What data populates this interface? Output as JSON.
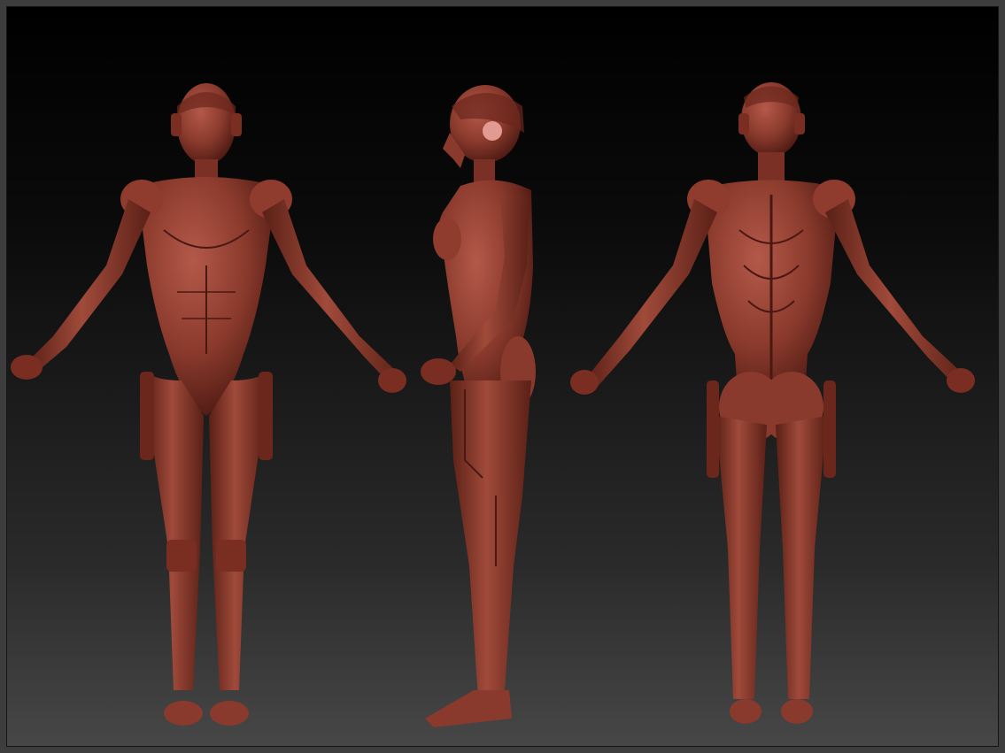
{
  "scene": {
    "background_top": "#000000",
    "background_bottom": "#474747",
    "border_color": "#3d3d3d",
    "clay_color": "#8a3a2c",
    "clay_highlight": "#b4594a",
    "clay_shadow": "#4a1812",
    "ear_disk_color": "#e39a93"
  },
  "views": [
    {
      "id": "front",
      "label": ""
    },
    {
      "id": "side",
      "label": ""
    },
    {
      "id": "back",
      "label": ""
    }
  ]
}
